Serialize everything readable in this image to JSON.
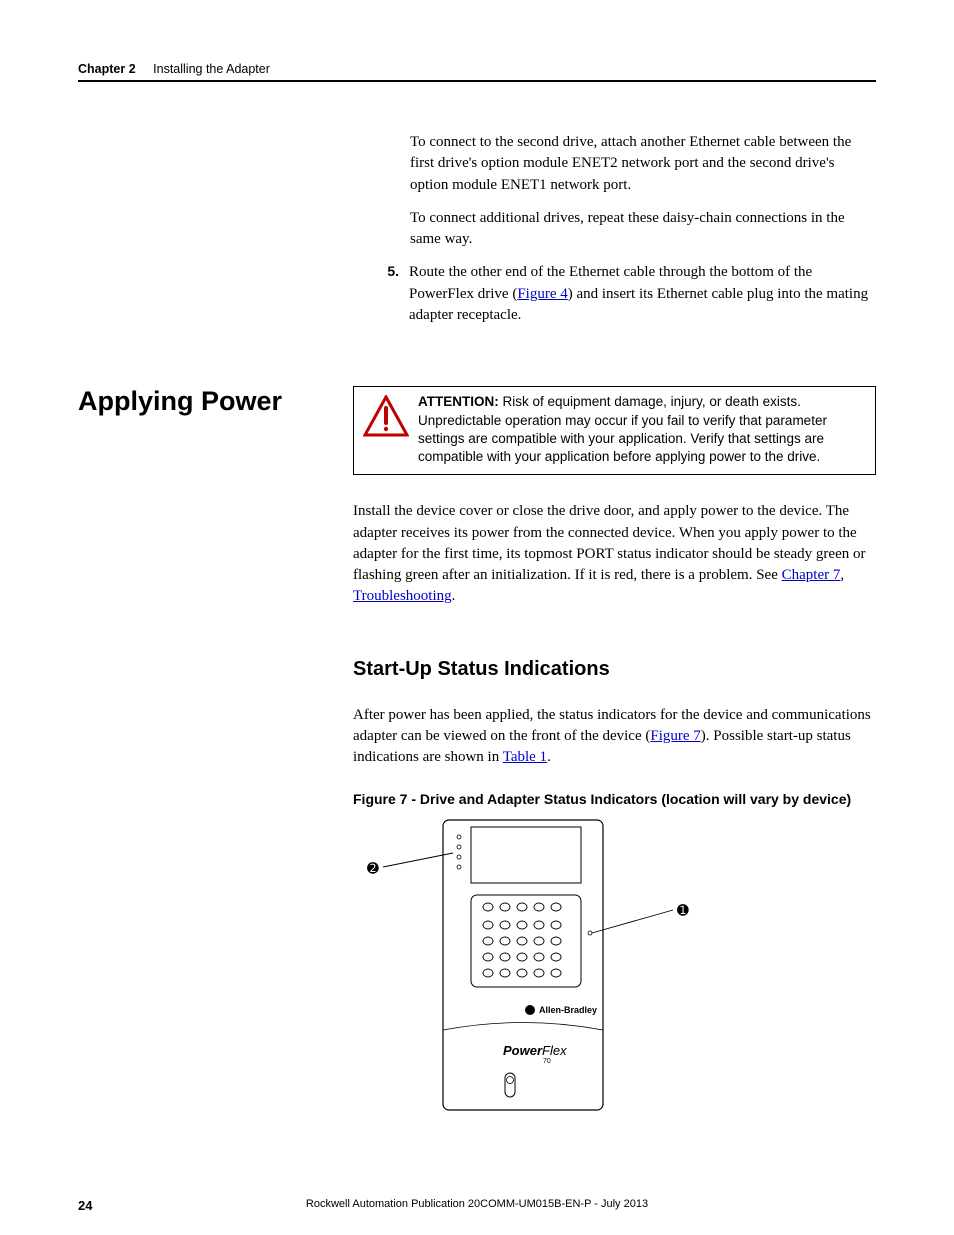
{
  "header": {
    "chapter": "Chapter 2",
    "title": "Installing the Adapter"
  },
  "intro": {
    "p1": "To connect to the second drive, attach another Ethernet cable between the first drive's option module ENET2 network port and the second drive's option module ENET1 network port.",
    "p2": "To connect additional drives, repeat these daisy-chain connections in the same way."
  },
  "step5": {
    "num": "5.",
    "text_before": "Route the other end of the Ethernet cable through the bottom of the PowerFlex drive (",
    "link": "Figure 4",
    "text_after": ") and insert its Ethernet cable plug into the mating adapter receptacle."
  },
  "section": {
    "title": "Applying Power",
    "attention_label": "ATTENTION:",
    "attention_body": " Risk of equipment damage, injury, or death exists. Unpredictable operation may occur if you fail to verify that parameter settings are compatible with your application. Verify that settings are compatible with your application before applying power to the drive.",
    "body_before": "Install the device cover or close the drive door, and apply power to the device. The adapter receives its power from the connected device. When you apply power to the adapter for the first time, its topmost PORT status indicator should be steady green or flashing green after an initialization. If it is red, there is a problem. See ",
    "link1": "Chapter 7",
    "sep": ", ",
    "link2": "Troubleshooting",
    "body_after": "."
  },
  "subsection": {
    "heading": "Start-Up Status Indications",
    "p_before": "After power has been applied, the status indicators for the device and communications adapter can be viewed on the front of the device (",
    "link1": "Figure 7",
    "p_mid": "). Possible start-up status indications are shown in ",
    "link2": "Table 1",
    "p_after": "."
  },
  "figure": {
    "caption": "Figure 7 - Drive and Adapter Status Indicators (location will vary by device)",
    "brand1": "Allen-Bradley",
    "brand2a": "Power",
    "brand2b": "Flex",
    "callout1": "➊",
    "callout2": "➋"
  },
  "footer": {
    "page": "24",
    "pub": "Rockwell Automation Publication 20COMM-UM015B-EN-P - July 2013"
  }
}
